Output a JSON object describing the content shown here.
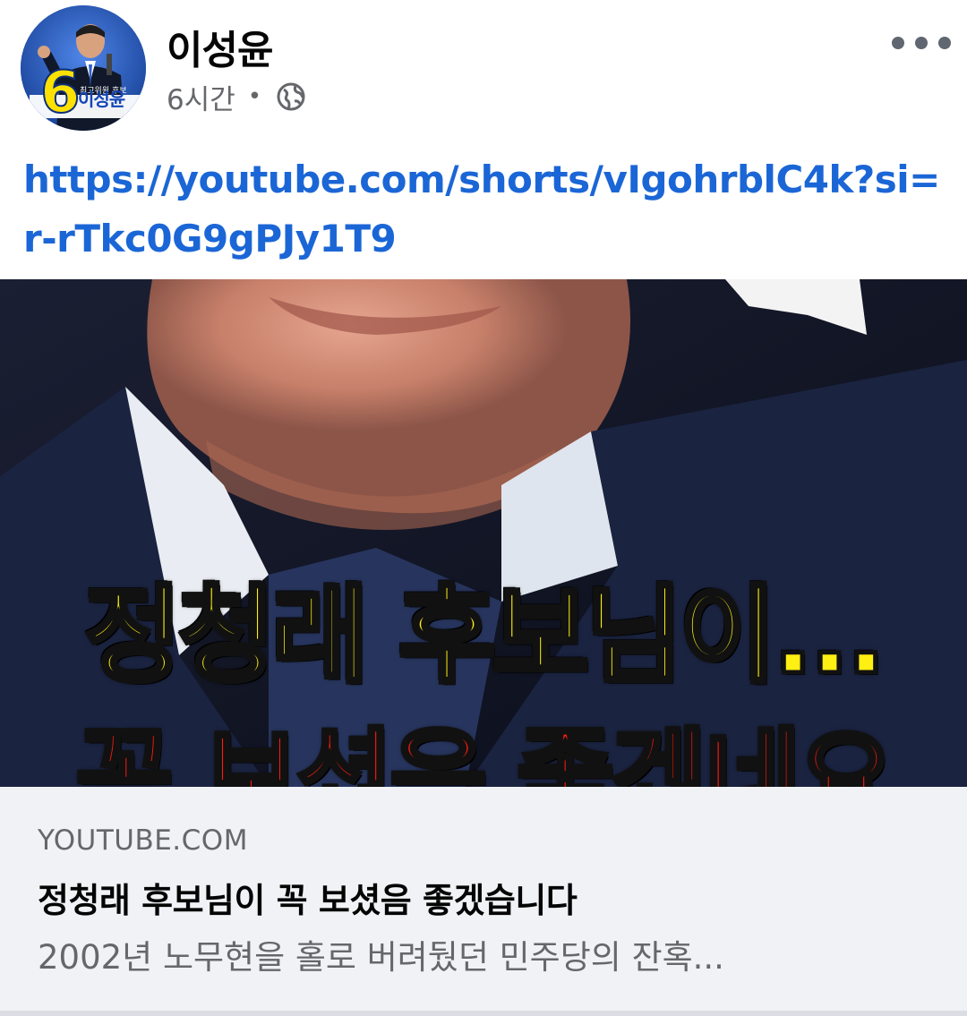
{
  "post": {
    "author": "이성윤",
    "time": "6시간",
    "separator": "•",
    "audience_icon": "globe-icon",
    "more_icon": "more-options-icon",
    "link": "https://youtube.com/shorts/vIgohrblC4k?si=r-rTkc0G9gPJy1T9"
  },
  "avatar": {
    "number": "6",
    "name": "이성윤"
  },
  "thumbnail": {
    "caption_line1": "정청래 후보님이...",
    "caption_line2": "꼭 보셨음 좋겠네요"
  },
  "card": {
    "domain": "YOUTUBE.COM",
    "title": "정청래 후보님이 꼭 보셨음 좋겠습니다",
    "description": "2002년 노무현을 홀로 버려뒀던 민주당의 잔혹..."
  },
  "colors": {
    "link": "#1b66d6",
    "caption_yellow": "#ffef12",
    "caption_red": "#ff1a12",
    "card_bg": "#f0f2f5",
    "secondary_text": "#65676b"
  }
}
